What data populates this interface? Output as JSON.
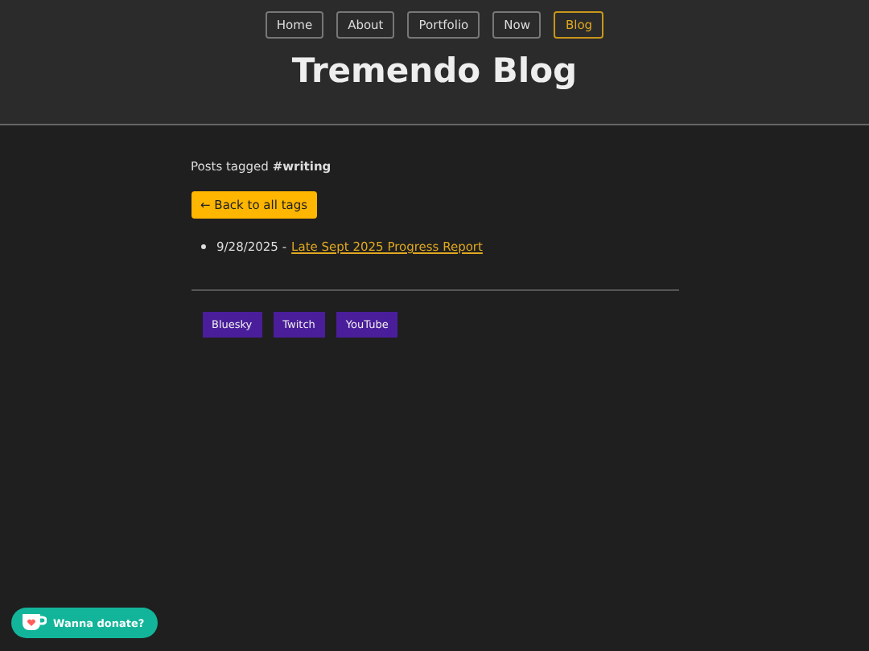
{
  "nav": [
    {
      "label": "Home",
      "selected": false
    },
    {
      "label": "About",
      "selected": false
    },
    {
      "label": "Portfolio",
      "selected": false
    },
    {
      "label": "Now",
      "selected": false
    },
    {
      "label": "Blog",
      "selected": true
    }
  ],
  "title": "Tremendo Blog",
  "heading": "Posts tagged **#writing**",
  "back_button": "← Back to all tags",
  "posts": [
    {
      "date": "9/28/2025 -",
      "title": "Late Sept 2025 Progress Report"
    }
  ],
  "social_links": [
    "Bluesky",
    "Twitch",
    "YouTube"
  ],
  "donate_button": "Wanna donate?"
}
